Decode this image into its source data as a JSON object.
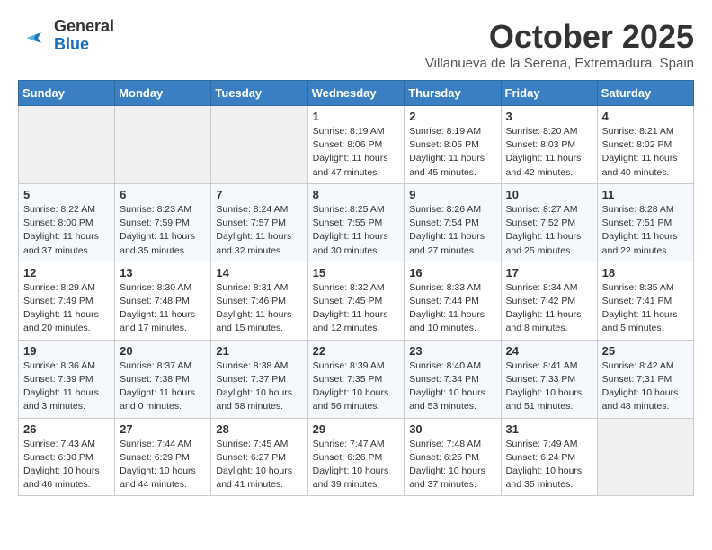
{
  "header": {
    "logo_general": "General",
    "logo_blue": "Blue",
    "month_title": "October 2025",
    "subtitle": "Villanueva de la Serena, Extremadura, Spain"
  },
  "weekdays": [
    "Sunday",
    "Monday",
    "Tuesday",
    "Wednesday",
    "Thursday",
    "Friday",
    "Saturday"
  ],
  "weeks": [
    [
      {
        "day": "",
        "info": ""
      },
      {
        "day": "",
        "info": ""
      },
      {
        "day": "",
        "info": ""
      },
      {
        "day": "1",
        "info": "Sunrise: 8:19 AM\nSunset: 8:06 PM\nDaylight: 11 hours\nand 47 minutes."
      },
      {
        "day": "2",
        "info": "Sunrise: 8:19 AM\nSunset: 8:05 PM\nDaylight: 11 hours\nand 45 minutes."
      },
      {
        "day": "3",
        "info": "Sunrise: 8:20 AM\nSunset: 8:03 PM\nDaylight: 11 hours\nand 42 minutes."
      },
      {
        "day": "4",
        "info": "Sunrise: 8:21 AM\nSunset: 8:02 PM\nDaylight: 11 hours\nand 40 minutes."
      }
    ],
    [
      {
        "day": "5",
        "info": "Sunrise: 8:22 AM\nSunset: 8:00 PM\nDaylight: 11 hours\nand 37 minutes."
      },
      {
        "day": "6",
        "info": "Sunrise: 8:23 AM\nSunset: 7:59 PM\nDaylight: 11 hours\nand 35 minutes."
      },
      {
        "day": "7",
        "info": "Sunrise: 8:24 AM\nSunset: 7:57 PM\nDaylight: 11 hours\nand 32 minutes."
      },
      {
        "day": "8",
        "info": "Sunrise: 8:25 AM\nSunset: 7:55 PM\nDaylight: 11 hours\nand 30 minutes."
      },
      {
        "day": "9",
        "info": "Sunrise: 8:26 AM\nSunset: 7:54 PM\nDaylight: 11 hours\nand 27 minutes."
      },
      {
        "day": "10",
        "info": "Sunrise: 8:27 AM\nSunset: 7:52 PM\nDaylight: 11 hours\nand 25 minutes."
      },
      {
        "day": "11",
        "info": "Sunrise: 8:28 AM\nSunset: 7:51 PM\nDaylight: 11 hours\nand 22 minutes."
      }
    ],
    [
      {
        "day": "12",
        "info": "Sunrise: 8:29 AM\nSunset: 7:49 PM\nDaylight: 11 hours\nand 20 minutes."
      },
      {
        "day": "13",
        "info": "Sunrise: 8:30 AM\nSunset: 7:48 PM\nDaylight: 11 hours\nand 17 minutes."
      },
      {
        "day": "14",
        "info": "Sunrise: 8:31 AM\nSunset: 7:46 PM\nDaylight: 11 hours\nand 15 minutes."
      },
      {
        "day": "15",
        "info": "Sunrise: 8:32 AM\nSunset: 7:45 PM\nDaylight: 11 hours\nand 12 minutes."
      },
      {
        "day": "16",
        "info": "Sunrise: 8:33 AM\nSunset: 7:44 PM\nDaylight: 11 hours\nand 10 minutes."
      },
      {
        "day": "17",
        "info": "Sunrise: 8:34 AM\nSunset: 7:42 PM\nDaylight: 11 hours\nand 8 minutes."
      },
      {
        "day": "18",
        "info": "Sunrise: 8:35 AM\nSunset: 7:41 PM\nDaylight: 11 hours\nand 5 minutes."
      }
    ],
    [
      {
        "day": "19",
        "info": "Sunrise: 8:36 AM\nSunset: 7:39 PM\nDaylight: 11 hours\nand 3 minutes."
      },
      {
        "day": "20",
        "info": "Sunrise: 8:37 AM\nSunset: 7:38 PM\nDaylight: 11 hours\nand 0 minutes."
      },
      {
        "day": "21",
        "info": "Sunrise: 8:38 AM\nSunset: 7:37 PM\nDaylight: 10 hours\nand 58 minutes."
      },
      {
        "day": "22",
        "info": "Sunrise: 8:39 AM\nSunset: 7:35 PM\nDaylight: 10 hours\nand 56 minutes."
      },
      {
        "day": "23",
        "info": "Sunrise: 8:40 AM\nSunset: 7:34 PM\nDaylight: 10 hours\nand 53 minutes."
      },
      {
        "day": "24",
        "info": "Sunrise: 8:41 AM\nSunset: 7:33 PM\nDaylight: 10 hours\nand 51 minutes."
      },
      {
        "day": "25",
        "info": "Sunrise: 8:42 AM\nSunset: 7:31 PM\nDaylight: 10 hours\nand 48 minutes."
      }
    ],
    [
      {
        "day": "26",
        "info": "Sunrise: 7:43 AM\nSunset: 6:30 PM\nDaylight: 10 hours\nand 46 minutes."
      },
      {
        "day": "27",
        "info": "Sunrise: 7:44 AM\nSunset: 6:29 PM\nDaylight: 10 hours\nand 44 minutes."
      },
      {
        "day": "28",
        "info": "Sunrise: 7:45 AM\nSunset: 6:27 PM\nDaylight: 10 hours\nand 41 minutes."
      },
      {
        "day": "29",
        "info": "Sunrise: 7:47 AM\nSunset: 6:26 PM\nDaylight: 10 hours\nand 39 minutes."
      },
      {
        "day": "30",
        "info": "Sunrise: 7:48 AM\nSunset: 6:25 PM\nDaylight: 10 hours\nand 37 minutes."
      },
      {
        "day": "31",
        "info": "Sunrise: 7:49 AM\nSunset: 6:24 PM\nDaylight: 10 hours\nand 35 minutes."
      },
      {
        "day": "",
        "info": ""
      }
    ]
  ]
}
